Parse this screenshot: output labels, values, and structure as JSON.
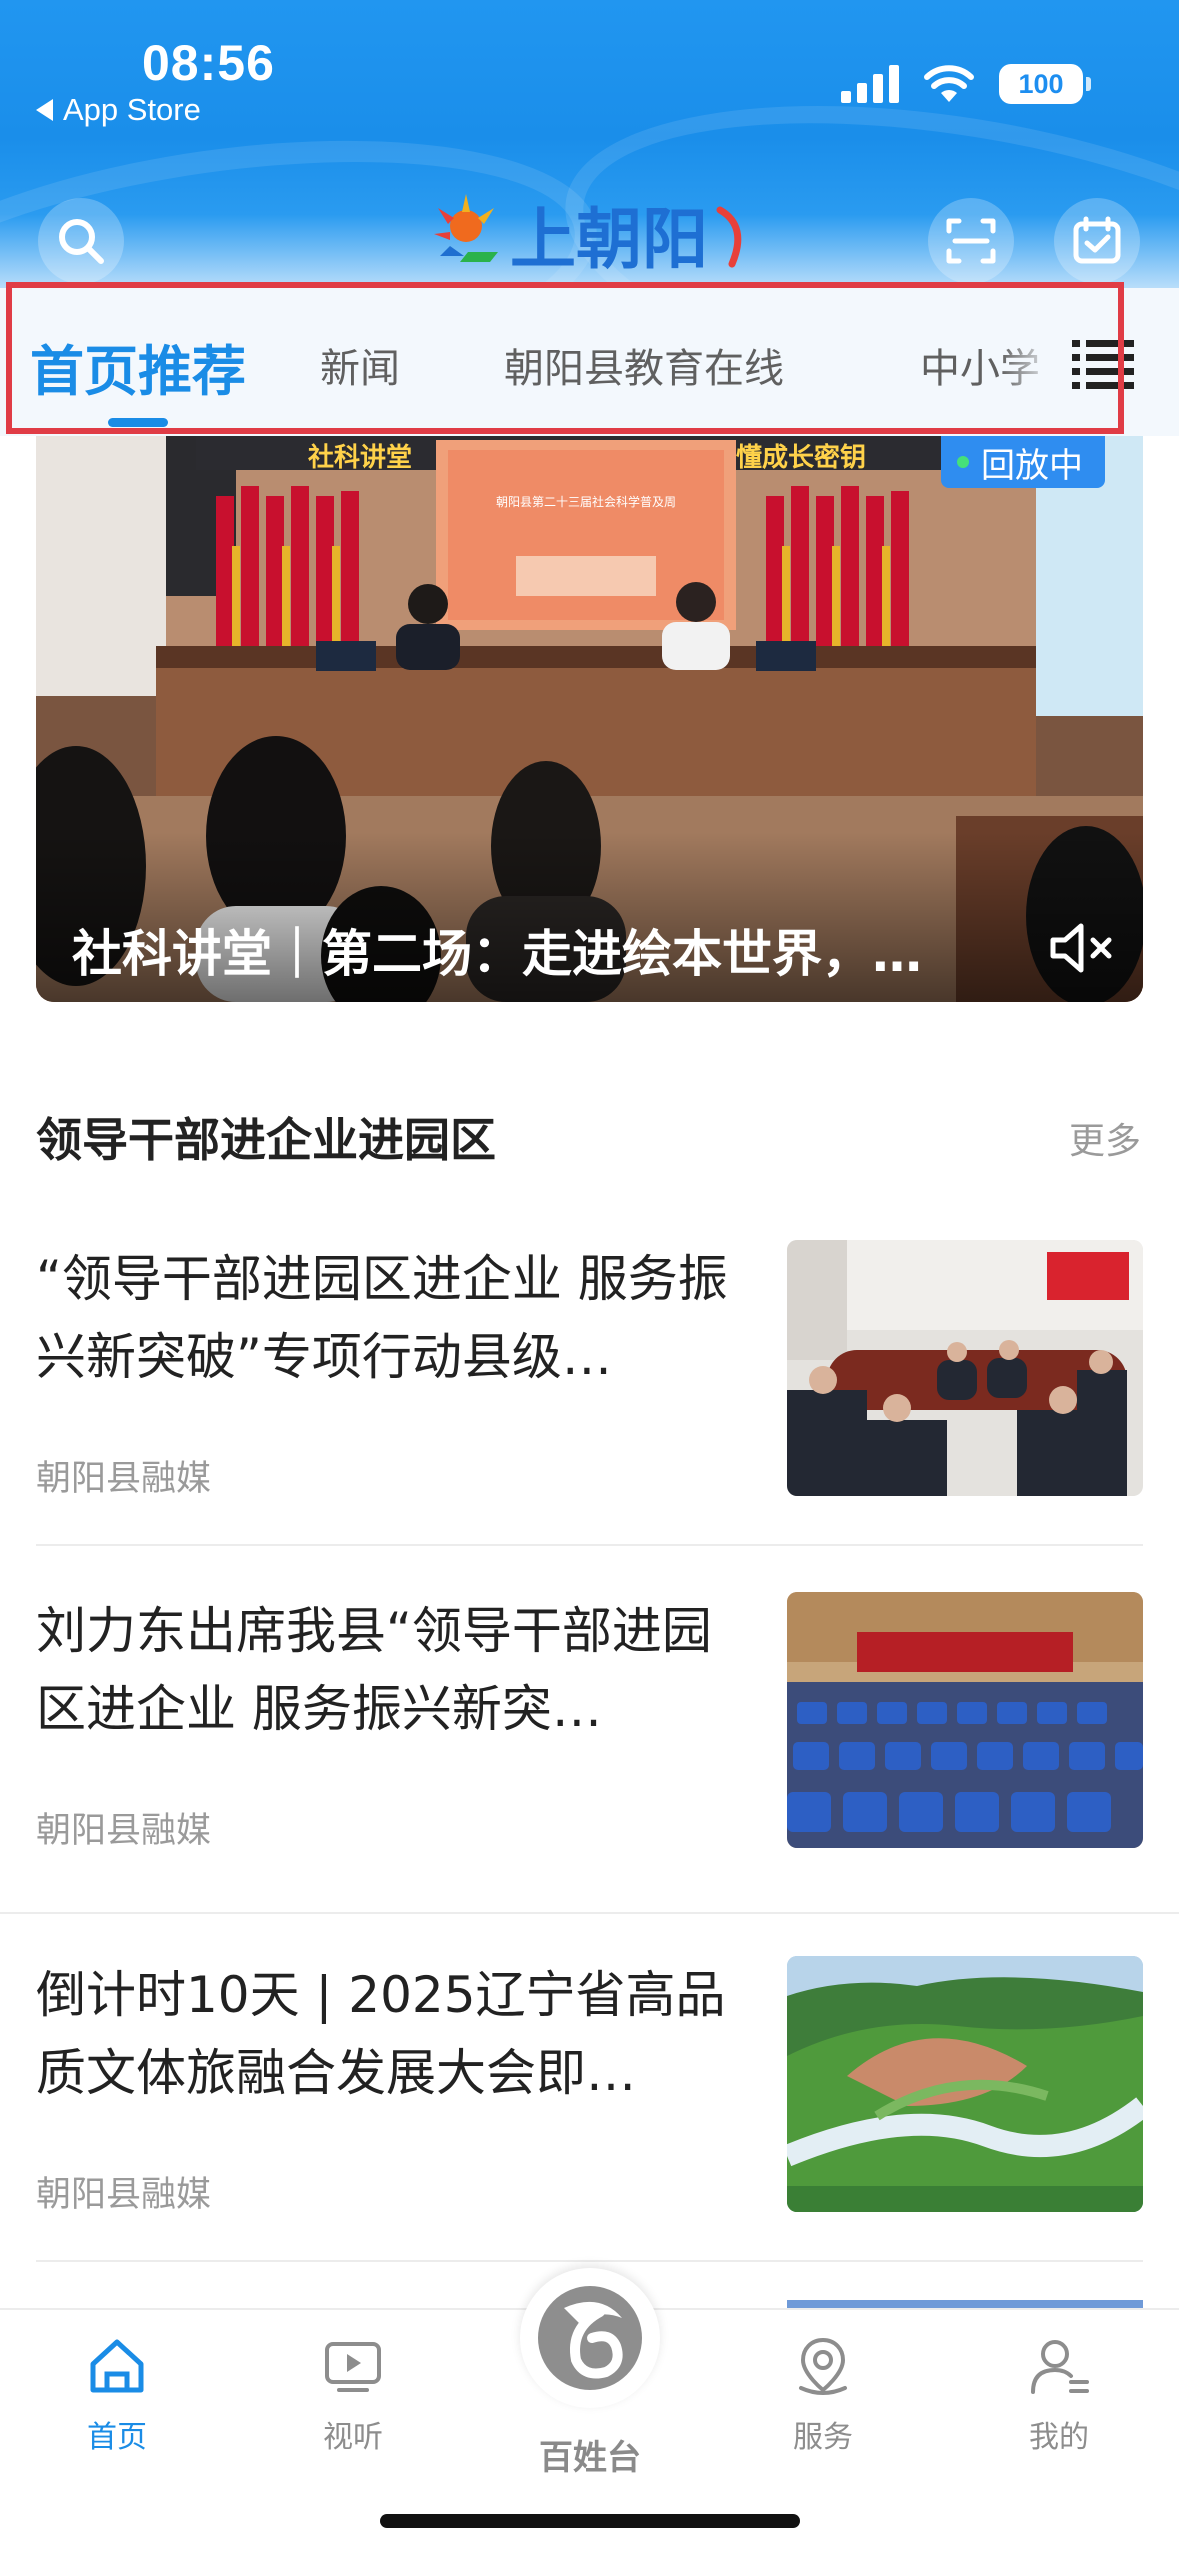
{
  "status_bar": {
    "time": "08:56",
    "back_label": "App Store",
    "battery": "100"
  },
  "header": {
    "logo_text": "上朝阳"
  },
  "tabs": [
    {
      "label": "首页推荐",
      "active": true
    },
    {
      "label": "新闻",
      "active": false
    },
    {
      "label": "朝阳县教育在线",
      "active": false
    },
    {
      "label": "中小学",
      "active": false
    }
  ],
  "hero": {
    "badge": "回放中",
    "title": "社科讲堂｜第二场：走进绘本世界，…",
    "banners": {
      "left": "社科讲堂",
      "screen_line1": "朝阳县第二十三届社会科学普及周",
      "right": "懂成长密钥"
    }
  },
  "section": {
    "title": "领导干部进企业进园区",
    "more": "更多"
  },
  "news": [
    {
      "title": "“领导干部进园区进企业 服务振兴新突破”专项行动县级…",
      "source": "朝阳县融媒"
    },
    {
      "title": "刘力东出席我县“领导干部进园区进企业 服务振兴新突…",
      "source": "朝阳县融媒"
    },
    {
      "title": "倒计时10天 | 2025辽宁省高品质文体旅融合发展大会即…",
      "source": "朝阳县融媒"
    }
  ],
  "bottom_nav": [
    {
      "label": "首页",
      "icon": "home-icon",
      "active": true
    },
    {
      "label": "视听",
      "icon": "tv-icon",
      "active": false
    },
    {
      "label": "百姓台",
      "icon": "logo-icon",
      "active": false
    },
    {
      "label": "服务",
      "icon": "location-icon",
      "active": false
    },
    {
      "label": "我的",
      "icon": "user-icon",
      "active": false
    }
  ],
  "colors": {
    "brand_blue": "#1a8ce6",
    "header_blue": "#2196f0",
    "highlight_red": "#e03c46"
  }
}
